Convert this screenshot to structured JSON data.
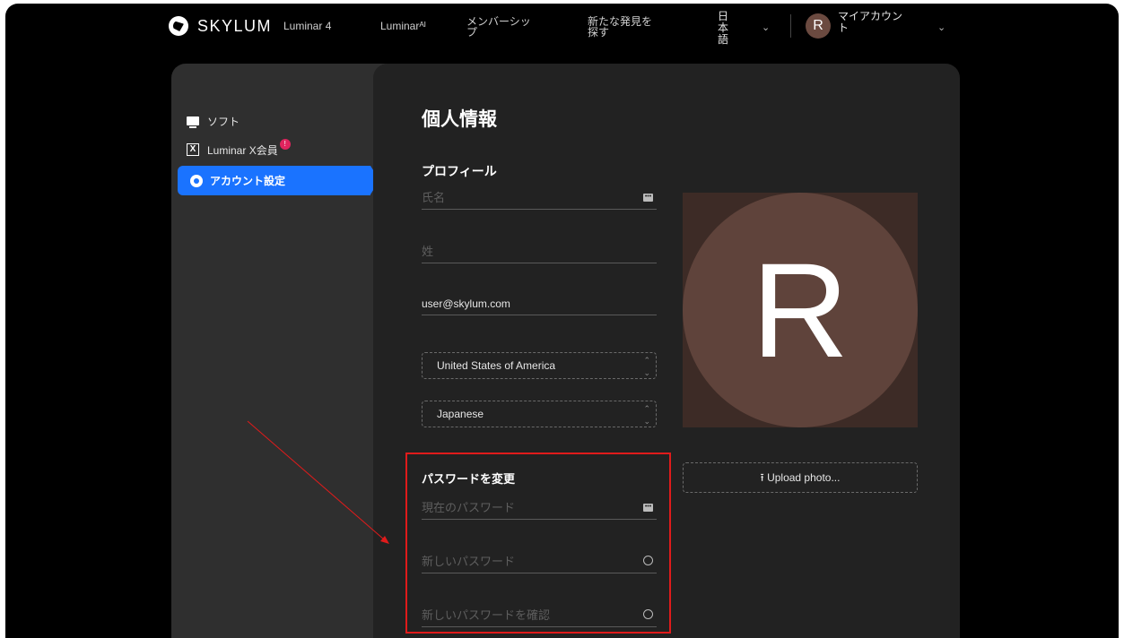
{
  "nav": {
    "brand": "SKYLUM",
    "links": [
      "Luminar 4",
      "Luminarᴬᴵ",
      "メンバーシップ",
      "新たな発見を探す"
    ],
    "language": "日本語",
    "avatar_letter": "R",
    "account": "マイアカウント"
  },
  "sidebar": {
    "items": [
      {
        "label": "ソフト",
        "icon": "monitor-icon"
      },
      {
        "label": "Luminar X会員",
        "icon": "luminar-x-icon",
        "badge": "!"
      },
      {
        "label": "アカウント設定",
        "icon": "gear-icon",
        "active": true
      }
    ]
  },
  "main": {
    "title": "個人情報",
    "profile_heading": "プロフィール",
    "first_name_placeholder": "氏名",
    "last_name_placeholder": "姓",
    "email": "user@skylum.com",
    "country": "United States of America",
    "language": "Japanese",
    "photo_letter": "R",
    "upload_label": "Upload photo...",
    "password_heading": "パスワードを変更",
    "current_password_placeholder": "現在のパスワード",
    "new_password_placeholder": "新しいパスワード",
    "confirm_password_placeholder": "新しいパスワードを確認"
  },
  "colors": {
    "accent": "#1a73ff",
    "highlight_box": "#e01b1b",
    "badge": "#e0245e",
    "avatar": "#5f433b"
  }
}
